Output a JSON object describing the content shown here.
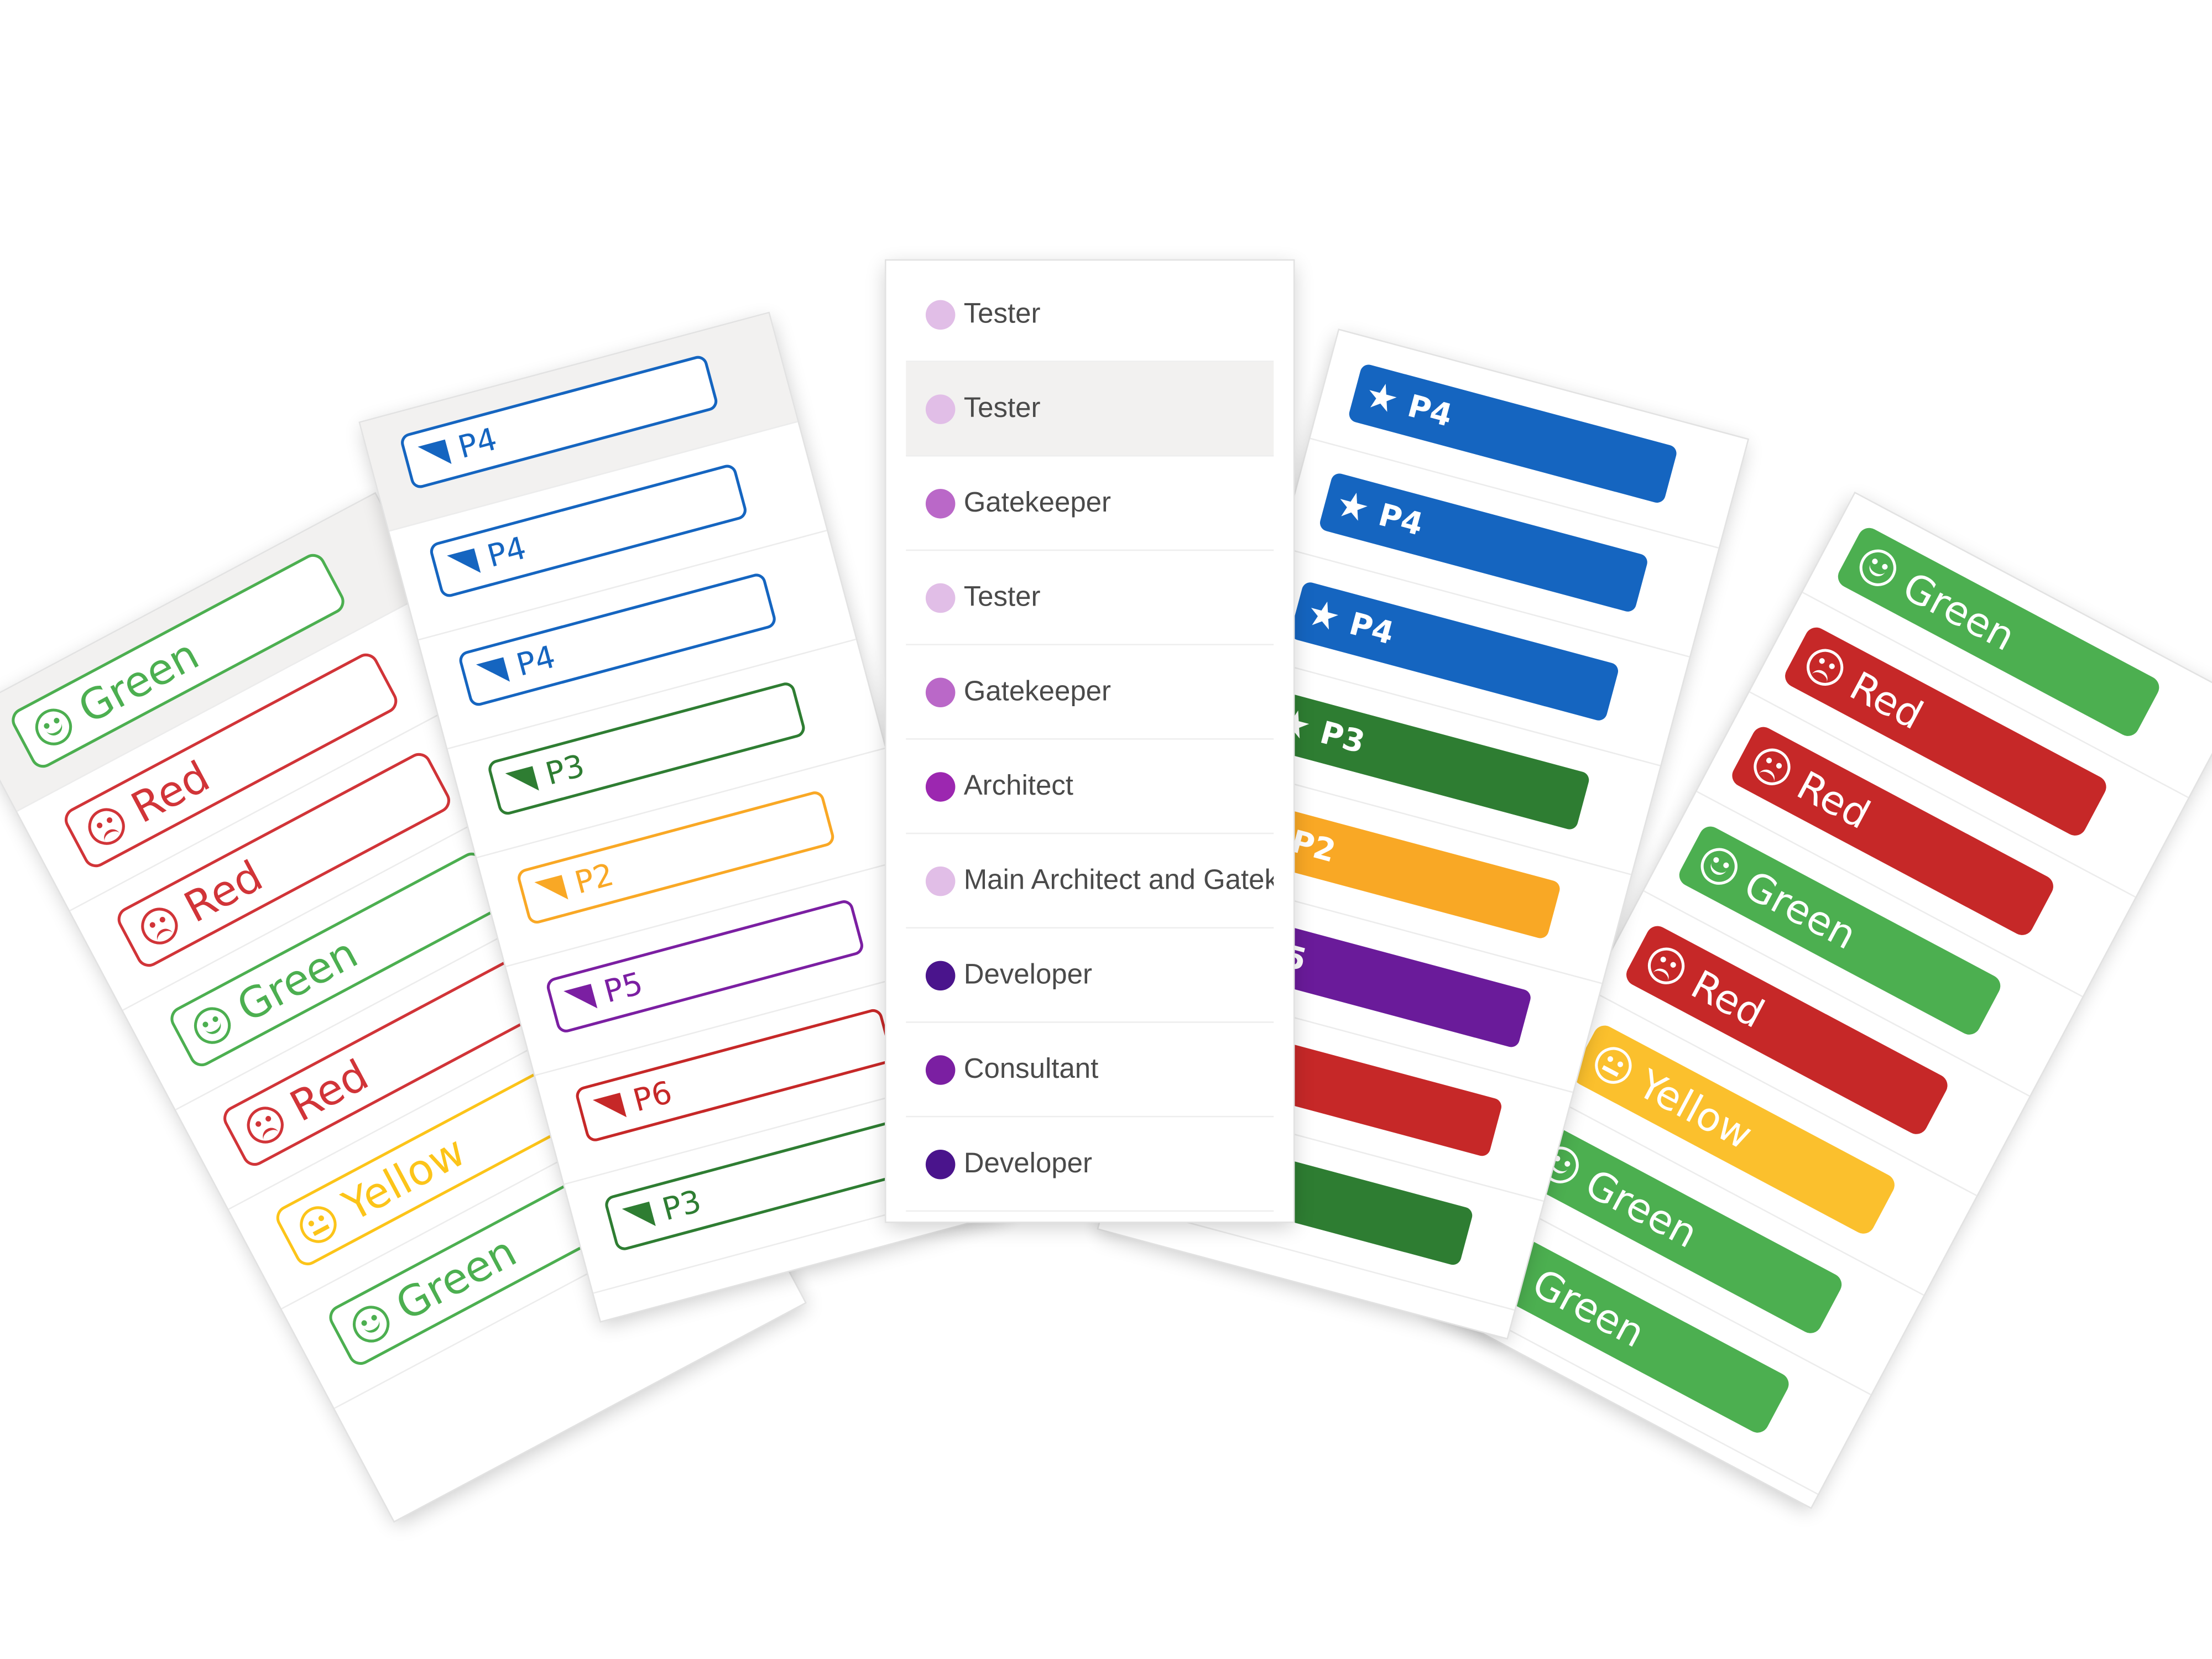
{
  "status_outline": {
    "items": [
      {
        "label": "Green",
        "mood": "happy",
        "color": "#4caf50"
      },
      {
        "label": "Red",
        "mood": "sad",
        "color": "#d13438"
      },
      {
        "label": "Red",
        "mood": "sad",
        "color": "#d13438"
      },
      {
        "label": "Green",
        "mood": "happy",
        "color": "#4caf50"
      },
      {
        "label": "Red",
        "mood": "sad",
        "color": "#d13438"
      },
      {
        "label": "Yellow",
        "mood": "neutral",
        "color": "#fcc419"
      },
      {
        "label": "Green",
        "mood": "happy",
        "color": "#4caf50"
      }
    ]
  },
  "priority_outline": {
    "items": [
      {
        "label": "P4",
        "color": "#1565c0"
      },
      {
        "label": "P4",
        "color": "#1565c0"
      },
      {
        "label": "P4",
        "color": "#1565c0"
      },
      {
        "label": "P3",
        "color": "#2e7d32"
      },
      {
        "label": "P2",
        "color": "#f9a825"
      },
      {
        "label": "P5",
        "color": "#7b1fa2"
      },
      {
        "label": "P6",
        "color": "#c62828"
      },
      {
        "label": "P3",
        "color": "#2e7d32"
      }
    ]
  },
  "role_dropdown": {
    "items": [
      {
        "label": "Tester",
        "color": "#e1bee7"
      },
      {
        "label": "Tester",
        "color": "#e1bee7"
      },
      {
        "label": "Gatekeeper",
        "color": "#ba68c8"
      },
      {
        "label": "Tester",
        "color": "#e1bee7"
      },
      {
        "label": "Gatekeeper",
        "color": "#ba68c8"
      },
      {
        "label": "Architect",
        "color": "#9c27b0"
      },
      {
        "label": "Main Architect and Gatekeeper",
        "color": "#e1bee7"
      },
      {
        "label": "Developer",
        "color": "#4a148c"
      },
      {
        "label": "Consultant",
        "color": "#7b1fa2"
      },
      {
        "label": "Developer",
        "color": "#4a148c"
      }
    ]
  },
  "priority_filled": {
    "items": [
      {
        "label": "P4",
        "color": "#1565c0"
      },
      {
        "label": "P4",
        "color": "#1565c0"
      },
      {
        "label": "P4",
        "color": "#1565c0"
      },
      {
        "label": "P3",
        "color": "#2e7d32"
      },
      {
        "label": "P2",
        "color": "#f9a825"
      },
      {
        "label": "P5",
        "color": "#6a1b9a"
      },
      {
        "label": "",
        "color": "#c62828"
      },
      {
        "label": "",
        "color": "#2e7d32"
      }
    ]
  },
  "status_filled": {
    "items": [
      {
        "label": "Green",
        "mood": "happy",
        "color": "#4caf50"
      },
      {
        "label": "Red",
        "mood": "sad",
        "color": "#c62828"
      },
      {
        "label": "Red",
        "mood": "sad",
        "color": "#c62828"
      },
      {
        "label": "Green",
        "mood": "happy",
        "color": "#4caf50"
      },
      {
        "label": "Red",
        "mood": "sad",
        "color": "#c62828"
      },
      {
        "label": "Yellow",
        "mood": "neutral",
        "color": "#fbc02d"
      },
      {
        "label": "Green",
        "mood": "happy",
        "color": "#4caf50"
      },
      {
        "label": "Green",
        "mood": "happy",
        "color": "#4caf50"
      }
    ]
  }
}
